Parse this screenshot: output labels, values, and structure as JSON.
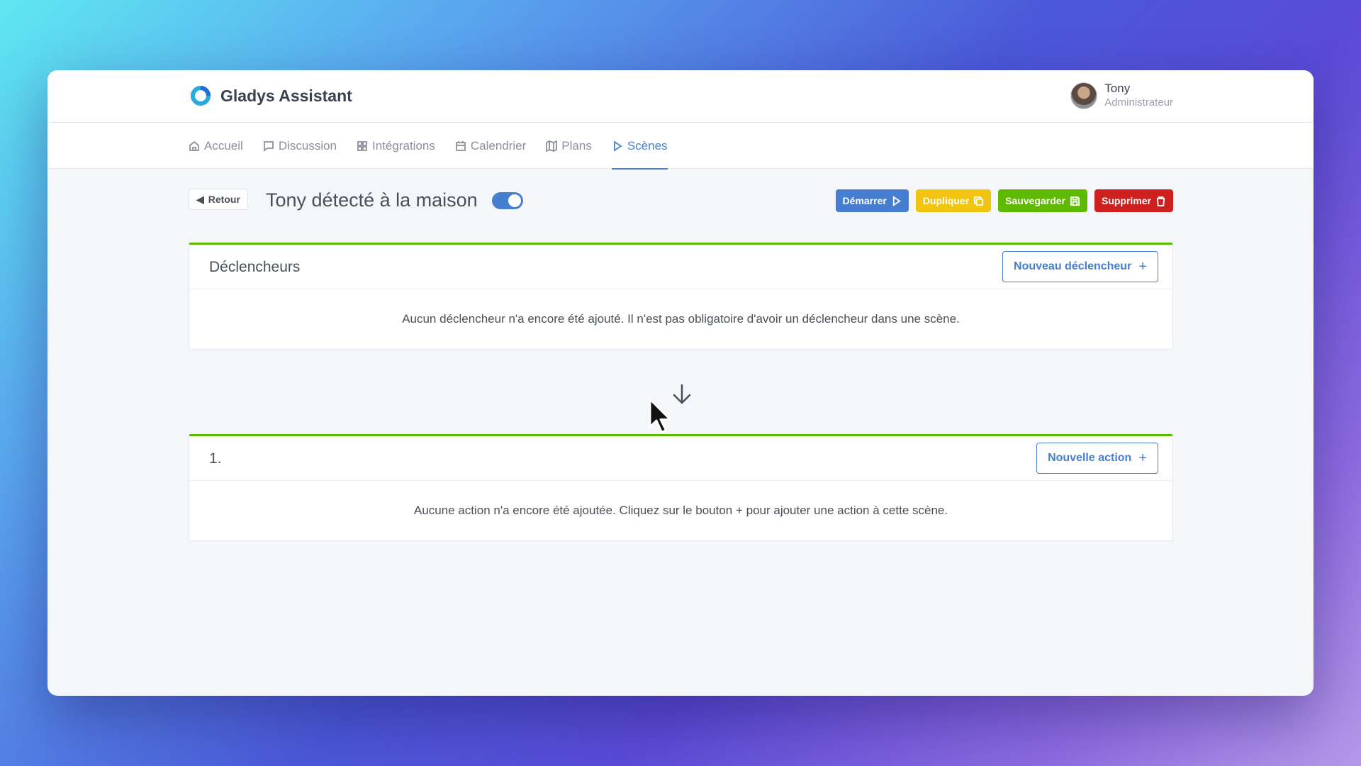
{
  "app": {
    "name": "Gladys Assistant"
  },
  "user": {
    "name": "Tony",
    "role": "Administrateur"
  },
  "nav": [
    {
      "label": "Accueil",
      "icon": "home-icon",
      "active": false
    },
    {
      "label": "Discussion",
      "icon": "message-icon",
      "active": false
    },
    {
      "label": "Intégrations",
      "icon": "grid-icon",
      "active": false
    },
    {
      "label": "Calendrier",
      "icon": "calendar-icon",
      "active": false
    },
    {
      "label": "Plans",
      "icon": "map-icon",
      "active": false
    },
    {
      "label": "Scènes",
      "icon": "play-icon",
      "active": true
    }
  ],
  "scene": {
    "back_label": "Retour",
    "title": "Tony détecté à la maison",
    "enabled": true
  },
  "actions": {
    "start": "Démarrer",
    "duplicate": "Dupliquer",
    "save": "Sauvegarder",
    "delete": "Supprimer"
  },
  "triggers": {
    "title": "Déclencheurs",
    "button": "Nouveau déclencheur",
    "empty": "Aucun déclencheur n'a encore été ajouté. Il n'est pas obligatoire d'avoir un déclencheur dans une scène."
  },
  "action_group": {
    "title": "1.",
    "button": "Nouvelle action",
    "empty": "Aucune action n'a encore été ajoutée. Cliquez sur le bouton + pour ajouter une action à cette scène."
  },
  "colors": {
    "primary": "#467fcf",
    "warning": "#f1c40f",
    "success": "#5eba00",
    "danger": "#cd201f"
  }
}
